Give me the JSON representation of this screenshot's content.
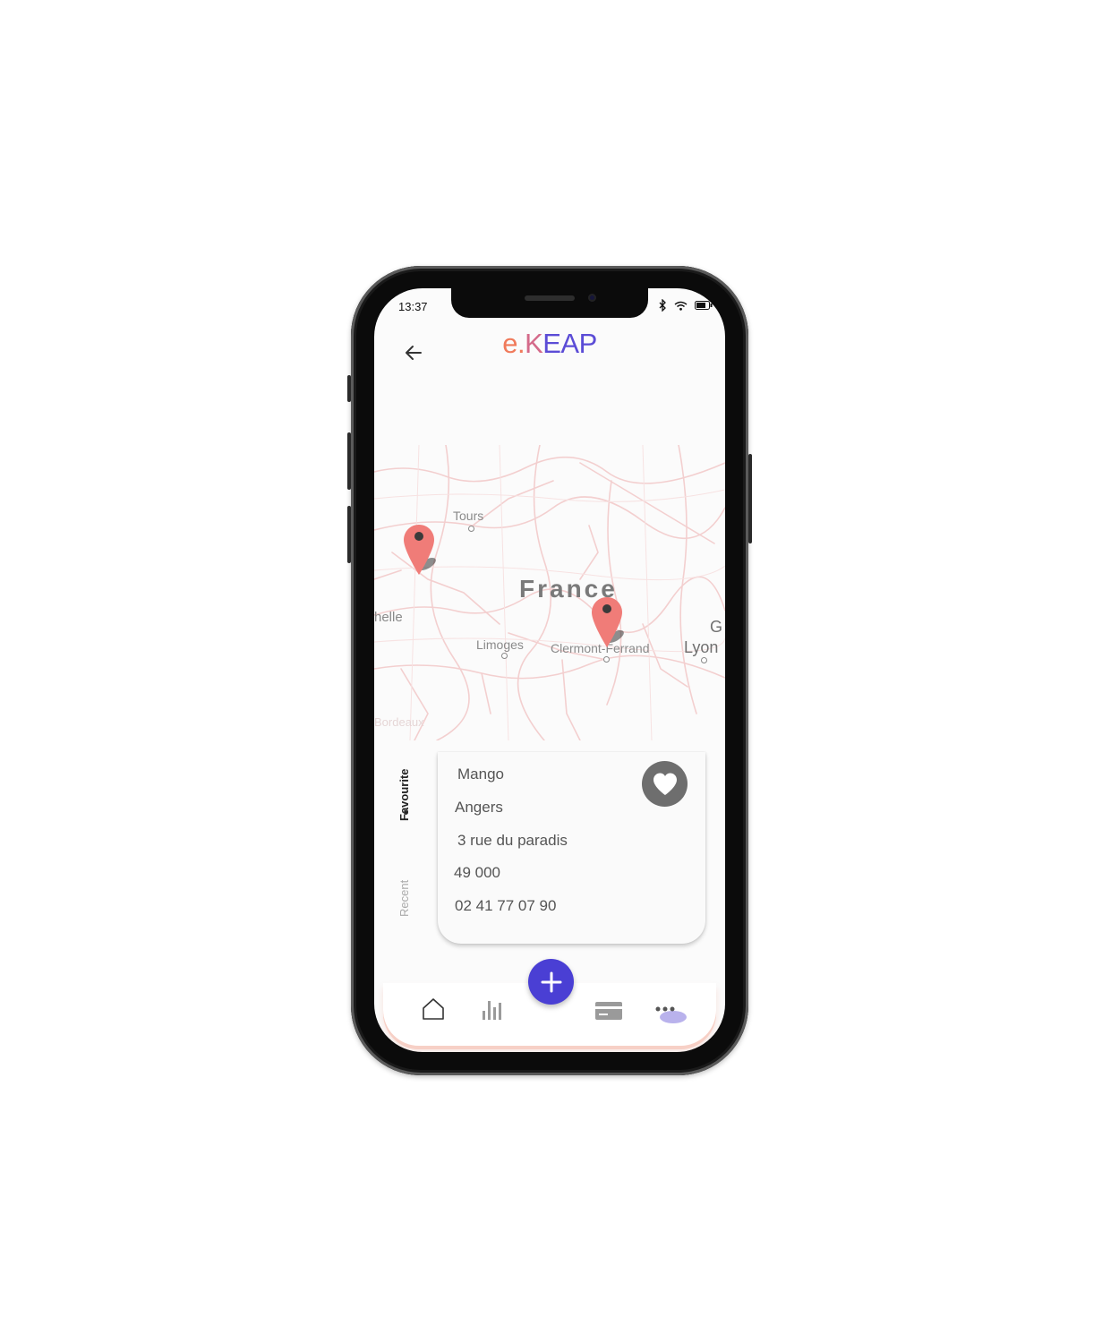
{
  "status_bar": {
    "time": "13:37"
  },
  "header": {
    "logo_e": "e.",
    "logo_k": "K",
    "logo_rest": "EAP"
  },
  "map": {
    "country": "France",
    "cities": {
      "tours": "Tours",
      "rochelle": "helle",
      "limoges": "Limoges",
      "clermont": "Clermont-Ferrand",
      "lyon": "Lyon",
      "g": "G",
      "bordeaux": "Bordeaux"
    },
    "pin_color": "#f07c78"
  },
  "side_tabs": {
    "favourite": "Favourite",
    "recent": "Recent"
  },
  "store_card": {
    "name": "Mango",
    "city": "Angers",
    "street": "3 rue du paradis",
    "postal_code": "49 000",
    "phone": "02 41 77 07 90"
  },
  "colors": {
    "accent": "#4a3fd4",
    "logo_orange": "#f07a5b",
    "logo_purple": "#5b4cd6",
    "nav_active": "#b9b2ec"
  },
  "icons": {
    "back": "arrow-left-icon",
    "favourite": "heart-icon",
    "home": "home-icon",
    "stats": "bar-chart-icon",
    "add": "plus-icon",
    "card": "credit-card-icon",
    "more": "more-icon"
  }
}
